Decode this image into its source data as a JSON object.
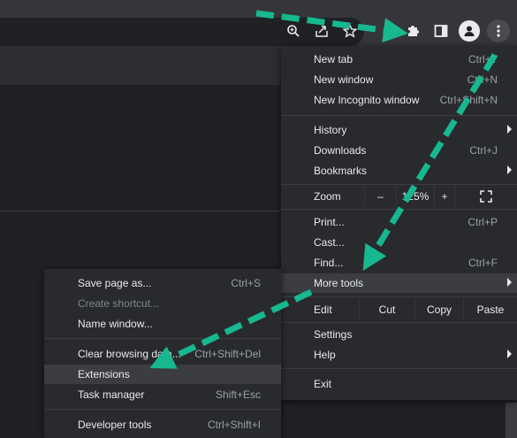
{
  "main_menu": {
    "new_tab": {
      "label": "New tab",
      "shortcut": "Ctrl+T"
    },
    "new_window": {
      "label": "New window",
      "shortcut": "Ctrl+N"
    },
    "incognito": {
      "label": "New Incognito window",
      "shortcut": "Ctrl+Shift+N"
    },
    "history": {
      "label": "History"
    },
    "downloads": {
      "label": "Downloads",
      "shortcut": "Ctrl+J"
    },
    "bookmarks": {
      "label": "Bookmarks"
    },
    "zoom": {
      "label": "Zoom",
      "minus": "–",
      "value": "125%",
      "plus": "+"
    },
    "print": {
      "label": "Print...",
      "shortcut": "Ctrl+P"
    },
    "cast": {
      "label": "Cast..."
    },
    "find": {
      "label": "Find...",
      "shortcut": "Ctrl+F"
    },
    "more_tools": {
      "label": "More tools"
    },
    "edit": {
      "label": "Edit",
      "cut": "Cut",
      "copy": "Copy",
      "paste": "Paste"
    },
    "settings": {
      "label": "Settings"
    },
    "help": {
      "label": "Help"
    },
    "exit": {
      "label": "Exit"
    }
  },
  "sub_menu": {
    "save_page": {
      "label": "Save page as...",
      "shortcut": "Ctrl+S"
    },
    "create_shortcut": {
      "label": "Create shortcut..."
    },
    "name_window": {
      "label": "Name window..."
    },
    "clear_browsing": {
      "label": "Clear browsing data...",
      "shortcut": "Ctrl+Shift+Del"
    },
    "extensions": {
      "label": "Extensions"
    },
    "task_manager": {
      "label": "Task manager",
      "shortcut": "Shift+Esc"
    },
    "dev_tools": {
      "label": "Developer tools",
      "shortcut": "Ctrl+Shift+I"
    }
  },
  "toolbar_icons": [
    "zoom-icon",
    "share-icon",
    "star-icon",
    "extensions-puzzle-icon",
    "side-panel-icon",
    "profile-icon",
    "kebab-menu-icon"
  ],
  "annotation_color": "#17b890"
}
